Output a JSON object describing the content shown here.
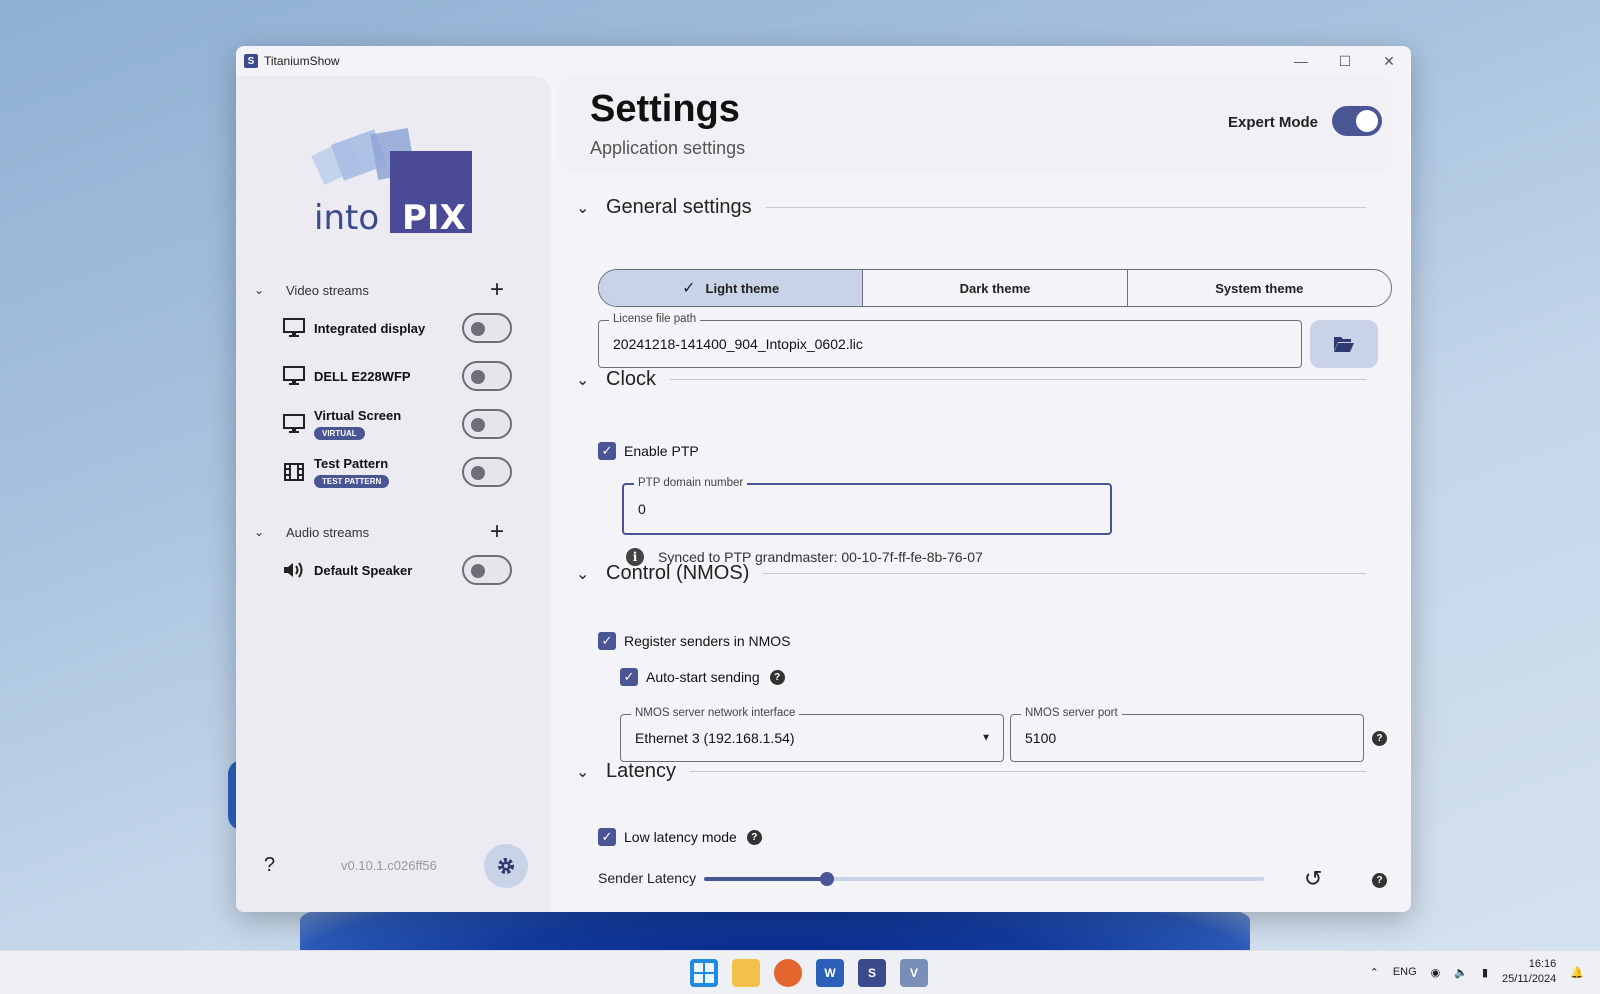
{
  "window": {
    "title": "TitaniumShow",
    "app_icon_letter": "S"
  },
  "sidebar": {
    "logo_text_left": "into",
    "logo_text_right": "PIX",
    "video_streams_label": "Video streams",
    "audio_streams_label": "Audio streams",
    "video_streams": [
      {
        "name": "Integrated display",
        "tag": "",
        "icon": "monitor-icon",
        "enabled": false
      },
      {
        "name": "DELL E228WFP",
        "tag": "",
        "icon": "monitor-icon",
        "enabled": false
      },
      {
        "name": "Virtual Screen",
        "tag": "VIRTUAL",
        "icon": "monitor-icon",
        "enabled": false
      },
      {
        "name": "Test Pattern",
        "tag": "TEST PATTERN",
        "icon": "film-icon",
        "enabled": false
      }
    ],
    "audio_streams": [
      {
        "name": "Default Speaker",
        "icon": "speaker-icon",
        "enabled": false
      }
    ],
    "help_label": "?",
    "version": "v0.10.1.c026ff56"
  },
  "header": {
    "title": "Settings",
    "subtitle": "Application settings",
    "expert_mode_label": "Expert Mode",
    "expert_mode_enabled": true
  },
  "general": {
    "title": "General settings",
    "themes": [
      "Light theme",
      "Dark theme",
      "System theme"
    ],
    "selected_theme": "Light theme",
    "license_label": "License file path",
    "license_value": "20241218-141400_904_Intopix_0602.lic"
  },
  "clock": {
    "title": "Clock",
    "enable_ptp_label": "Enable PTP",
    "enable_ptp_checked": true,
    "ptp_domain_label": "PTP domain number",
    "ptp_domain_value": "0",
    "synced_text": "Synced to PTP grandmaster: 00-10-7f-ff-fe-8b-76-07"
  },
  "control": {
    "title": "Control (NMOS)",
    "register_label": "Register senders in NMOS",
    "register_checked": true,
    "autostart_label": "Auto-start sending",
    "autostart_checked": true,
    "interface_label": "NMOS server network interface",
    "interface_value": "Ethernet 3 (192.168.1.54)",
    "port_label": "NMOS server port",
    "port_value": "5100"
  },
  "latency": {
    "title": "Latency",
    "low_latency_label": "Low latency mode",
    "low_latency_checked": true,
    "sender_latency_label": "Sender Latency",
    "sender_latency_fraction": 0.22
  },
  "taskbar": {
    "language": "ENG",
    "time": "16:16",
    "date": "25/11/2024"
  },
  "colors": {
    "accent": "#4a5694",
    "accent_light": "#c9d3e8"
  }
}
